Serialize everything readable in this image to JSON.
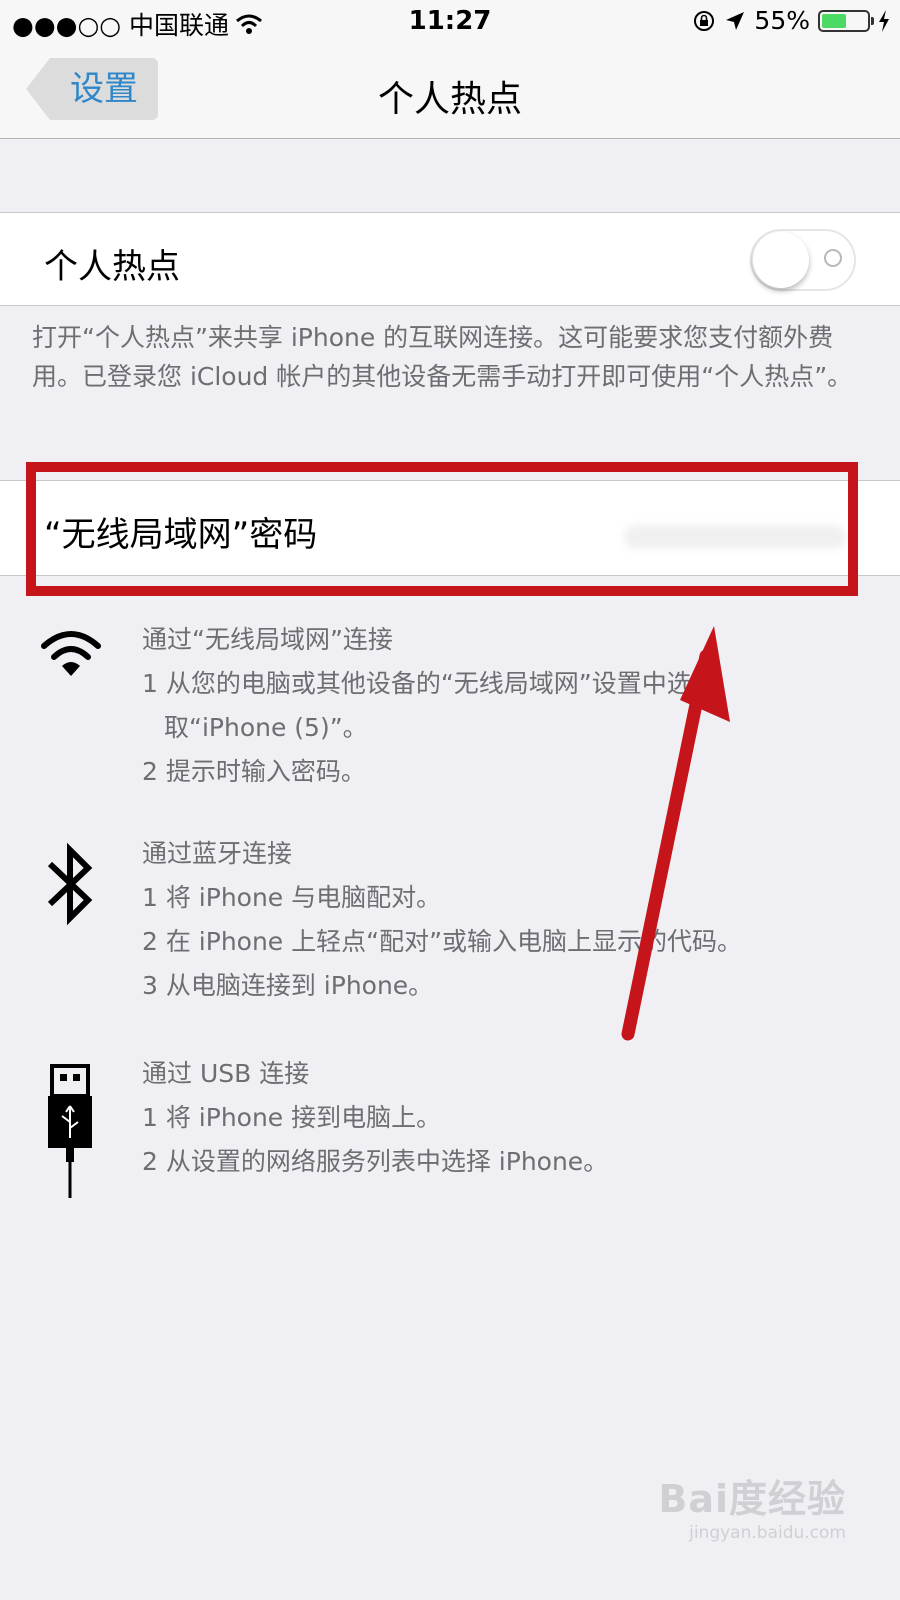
{
  "status_bar": {
    "carrier": "●●●○○ 中国联通",
    "time": "11:27",
    "battery": "55%",
    "battery_level": 0.55
  },
  "nav": {
    "back_label": "设置",
    "title": "个人热点"
  },
  "hotspot_cell": {
    "label": "个人热点",
    "toggle_on": false
  },
  "hotspot_footer": "打开“个人热点”来共享 iPhone 的互联网连接。这可能要求您支付额外费用。已登录您 iCloud 帐户的其他设备无需手动打开即可使用“个人热点”。",
  "wifi_password_cell": {
    "label": "“无线局域网”密码"
  },
  "methods": {
    "wifi": {
      "title": "通过“无线局域网”连接",
      "step1": "1 从您的电脑或其他设备的“无线局域网”设置中选",
      "step1b": "取“iPhone (5)”。",
      "step2": "2 提示时输入密码。"
    },
    "bluetooth": {
      "title": "通过蓝牙连接",
      "step1": "1 将 iPhone 与电脑配对。",
      "step2": "2 在 iPhone 上轻点“配对”或输入电脑上显示的代码。",
      "step3": "3 从电脑连接到 iPhone。"
    },
    "usb": {
      "title": "通过 USB 连接",
      "step1": "1 将 iPhone 接到电脑上。",
      "step2": "2 从设置的网络服务列表中选择 iPhone。"
    }
  },
  "watermark": {
    "logo": "Bai度经验",
    "url": "jingyan.baidu.com"
  },
  "colors": {
    "accent": "#2f87c9",
    "annotation_red": "#c5151a",
    "background": "#efeff4"
  }
}
